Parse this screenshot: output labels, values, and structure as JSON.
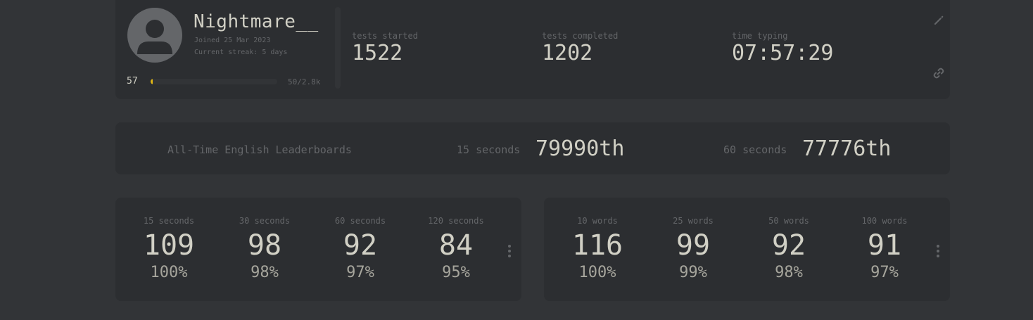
{
  "profile": {
    "username": "Nightmare__",
    "joined": "Joined 25 Mar 2023",
    "streak": "Current streak: 5 days",
    "level": "57",
    "xp_text": "50/2.8k",
    "xp_fraction": 0.018,
    "stats": [
      {
        "label": "tests started",
        "value": "1522"
      },
      {
        "label": "tests completed",
        "value": "1202"
      },
      {
        "label": "time typing",
        "value": "07:57:29"
      }
    ]
  },
  "leaderboard": {
    "title": "All-Time English Leaderboards",
    "entries": [
      {
        "label": "15 seconds",
        "rank": "79990th"
      },
      {
        "label": "60 seconds",
        "rank": "77776th"
      }
    ]
  },
  "pb_time": [
    {
      "mode": "15 seconds",
      "wpm": "109",
      "acc": "100%"
    },
    {
      "mode": "30 seconds",
      "wpm": "98",
      "acc": "98%"
    },
    {
      "mode": "60 seconds",
      "wpm": "92",
      "acc": "97%"
    },
    {
      "mode": "120 seconds",
      "wpm": "84",
      "acc": "95%"
    }
  ],
  "pb_words": [
    {
      "mode": "10 words",
      "wpm": "116",
      "acc": "100%"
    },
    {
      "mode": "25 words",
      "wpm": "99",
      "acc": "99%"
    },
    {
      "mode": "50 words",
      "wpm": "92",
      "acc": "98%"
    },
    {
      "mode": "100 words",
      "wpm": "91",
      "acc": "97%"
    }
  ],
  "icons": {
    "edit": "pencil-icon",
    "link": "link-icon",
    "more": "more-vertical-icon",
    "avatar": "user-avatar-icon"
  },
  "colors": {
    "background": "#323437",
    "card": "#2c2e31",
    "text": "#d1d0c5",
    "subtext": "#646669",
    "accent": "#e2b714"
  }
}
